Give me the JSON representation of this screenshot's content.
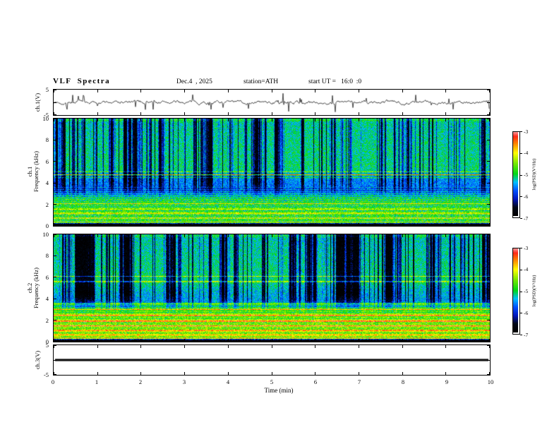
{
  "figure": {
    "title": "VLF  Spectra",
    "date": "Dec.4  , 2025",
    "station": "station=ATH",
    "start_ut": "start UT =   16:0  :0"
  },
  "xaxis": {
    "label": "Time  (min)",
    "min": 0,
    "max": 10,
    "ticks": [
      0,
      1,
      2,
      3,
      4,
      5,
      6,
      7,
      8,
      9,
      10
    ]
  },
  "colorbar": {
    "label": "log(PSD)(V²/Hz)",
    "min": -7,
    "max": -3,
    "ticks": [
      -3,
      -4,
      -5,
      -6,
      -7
    ],
    "stops": [
      {
        "p": 0.0,
        "c": "#000000"
      },
      {
        "p": 0.1,
        "c": "#000818"
      },
      {
        "p": 0.2,
        "c": "#0018c0"
      },
      {
        "p": 0.3,
        "c": "#0050ff"
      },
      {
        "p": 0.4,
        "c": "#00c0ff"
      },
      {
        "p": 0.5,
        "c": "#00d818"
      },
      {
        "p": 0.62,
        "c": "#70e800"
      },
      {
        "p": 0.75,
        "c": "#ffff00"
      },
      {
        "p": 0.87,
        "c": "#ff8000"
      },
      {
        "p": 0.95,
        "c": "#ff2818"
      },
      {
        "p": 1.0,
        "c": "#ff9090"
      }
    ]
  },
  "panels": {
    "wave1": {
      "ylabel": "ch.1(V)",
      "ymin": -5,
      "ymax": 5,
      "yticks": [
        5,
        -5
      ]
    },
    "spec1": {
      "ylabel_line1": "ch.1",
      "ylabel_line2": "Frequency (kHz)",
      "ymin": 0,
      "ymax": 10,
      "yticks": [
        10,
        8,
        6,
        4,
        2,
        0
      ]
    },
    "spec2": {
      "ylabel_line1": "ch.2",
      "ylabel_line2": "Frequency (kHz)",
      "ymin": 0,
      "ymax": 10,
      "yticks": [
        10,
        8,
        6,
        4,
        2,
        0
      ]
    },
    "wave3": {
      "ylabel": "ch.3(V)",
      "ymin": -5,
      "ymax": 5,
      "yticks": [
        5,
        -5
      ]
    }
  },
  "chart_data": {
    "type": "heatmap",
    "title": "VLF Spectra",
    "subtitle": {
      "date": "Dec.4, 2025",
      "station": "ATH",
      "start_ut": "16:0:0"
    },
    "x": {
      "label": "Time (min)",
      "range": [
        0,
        10
      ],
      "ticks": [
        0,
        1,
        2,
        3,
        4,
        5,
        6,
        7,
        8,
        9,
        10
      ]
    },
    "colorbar": {
      "label": "log(PSD)(V²/Hz)",
      "range": [
        -7,
        -3
      ],
      "ticks": [
        -3,
        -4,
        -5,
        -6,
        -7
      ]
    },
    "panels": [
      {
        "name": "ch.1(V)",
        "type": "line",
        "yrange": [
          -5,
          5
        ],
        "ytick_labels": [
          5,
          -5
        ],
        "summary": "broadband noisy waveform centered near 0 V with frequent impulsive spikes up to about ±3 V",
        "seed": 7,
        "spike_prob": 0.055
      },
      {
        "name": "ch.1 spectrogram",
        "type": "spectrogram",
        "ylabel": "Frequency (kHz)",
        "yrange": [
          0,
          10
        ],
        "psd_range": [
          -7,
          -3
        ],
        "seed": 11,
        "summary": "green/cyan background near -5 with dense dark-blue vertical sferic streaks above ~3 kHz, darker blue zone 3.3-4.6 kHz, bright pale lines near 4.7-5.1 kHz, bright banded structure 0.3-2 kHz, black band below ~0.15 kHz",
        "profile": [
          [
            0,
            -5.0
          ],
          [
            0.3,
            -4.85
          ],
          [
            2.5,
            -5.0
          ],
          [
            3.3,
            -5.75
          ],
          [
            4.6,
            -5.55
          ],
          [
            5.3,
            -5.1
          ],
          [
            10,
            -5.25
          ]
        ],
        "bands": [
          {
            "f": 9.9,
            "w": 0.12,
            "a": 0.35
          },
          {
            "f": 5.05,
            "w": 0.04,
            "a": 1.1
          },
          {
            "f": 4.75,
            "w": 0.04,
            "a": 2.4
          },
          {
            "f": 4.5,
            "w": 0.05,
            "a": 0.8
          },
          {
            "f": 2.05,
            "w": 0.07,
            "a": 0.7
          },
          {
            "f": 1.55,
            "w": 0.07,
            "a": 0.8
          },
          {
            "f": 1.15,
            "w": 0.08,
            "a": 0.9
          },
          {
            "f": 0.7,
            "w": 0.07,
            "a": 0.7
          },
          {
            "f": 0.32,
            "w": 0.06,
            "a": 0.6
          },
          {
            "f": 0.1,
            "w": 0.1,
            "a": -2.5
          }
        ],
        "streak_depth": 1.75
      },
      {
        "name": "ch.2 spectrogram",
        "type": "spectrogram",
        "ylabel": "Frequency (kHz)",
        "yrange": [
          0,
          10
        ],
        "psd_range": [
          -7,
          -3
        ],
        "seed": 23,
        "summary": "same sferic streak pattern above ~3 kHz; lower half brighter with strong yellow/orange horizontal bands near 0.3-3.5 kHz reaching -4 to -3.5, pale lines near 5.6 and 6.1 kHz, black band below ~0.15 kHz",
        "profile": [
          [
            0,
            -4.75
          ],
          [
            0.4,
            -4.5
          ],
          [
            2.9,
            -4.7
          ],
          [
            3.8,
            -5.5
          ],
          [
            4.8,
            -5.35
          ],
          [
            5.6,
            -5.1
          ],
          [
            10,
            -5.3
          ]
        ],
        "bands": [
          {
            "f": 9.9,
            "w": 0.12,
            "a": 0.35
          },
          {
            "f": 6.1,
            "w": 0.03,
            "a": 1.0
          },
          {
            "f": 5.6,
            "w": 0.04,
            "a": 1.6
          },
          {
            "f": 3.5,
            "w": 0.07,
            "a": 1.0
          },
          {
            "f": 3.0,
            "w": 0.07,
            "a": 1.1
          },
          {
            "f": 2.45,
            "w": 0.08,
            "a": 1.3
          },
          {
            "f": 1.9,
            "w": 0.08,
            "a": 1.5
          },
          {
            "f": 1.45,
            "w": 0.07,
            "a": 1.3
          },
          {
            "f": 1.0,
            "w": 0.07,
            "a": 1.2
          },
          {
            "f": 0.6,
            "w": 0.06,
            "a": 1.0
          },
          {
            "f": 0.3,
            "w": 0.05,
            "a": 0.8
          },
          {
            "f": 0.1,
            "w": 0.1,
            "a": -2.5
          }
        ],
        "streak_depth": 1.75
      },
      {
        "name": "ch.3(V)",
        "type": "line",
        "yrange": [
          -5,
          5
        ],
        "ytick_labels": [
          5,
          -5
        ],
        "flat_value": 0,
        "summary": "constant 0 V flat thick black line (channel silent)"
      }
    ]
  }
}
